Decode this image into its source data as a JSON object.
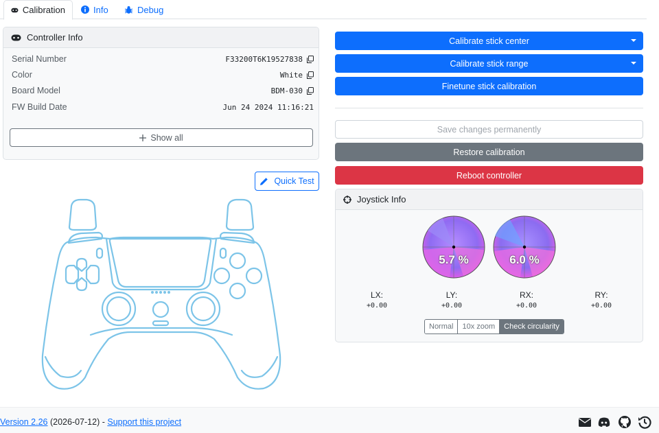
{
  "tabs": [
    {
      "label": "Calibration",
      "icon": "gamepad-icon"
    },
    {
      "label": "Info",
      "icon": "info-circle-icon"
    },
    {
      "label": "Debug",
      "icon": "bug-icon"
    }
  ],
  "controller_info": {
    "title": "Controller Info",
    "rows": [
      {
        "label": "Serial Number",
        "value": "F33200T6K19527838",
        "copyable": true
      },
      {
        "label": "Color",
        "value": "White",
        "copyable": true
      },
      {
        "label": "Board Model",
        "value": "BDM-030",
        "copyable": true
      },
      {
        "label": "FW Build Date",
        "value": "Jun 24 2024 11:16:21",
        "copyable": false
      }
    ],
    "show_all": "Show all"
  },
  "quick_test": "Quick Test",
  "actions": {
    "calibrate_center": "Calibrate stick center",
    "calibrate_range": "Calibrate stick range",
    "finetune": "Finetune stick calibration",
    "save": "Save changes permanently",
    "restore": "Restore calibration",
    "reboot": "Reboot controller"
  },
  "joystick": {
    "title": "Joystick Info",
    "left_error": "5.7 %",
    "right_error": "6.0 %",
    "axes": [
      {
        "label": "LX:",
        "value": "+0.00"
      },
      {
        "label": "LY:",
        "value": "+0.00"
      },
      {
        "label": "RX:",
        "value": "+0.00"
      },
      {
        "label": "RY:",
        "value": "+0.00"
      }
    ],
    "modes": [
      "Normal",
      "10x zoom",
      "Check circularity"
    ],
    "active_mode": "Check circularity"
  },
  "footer": {
    "version": "Version 2.26",
    "date": " (2026-07-12) - ",
    "support": "Support this project"
  },
  "colors": {
    "primary": "#0d6efd",
    "secondary": "#6c757d",
    "danger": "#dc3545",
    "controller_outline": "#7cc4e8"
  }
}
